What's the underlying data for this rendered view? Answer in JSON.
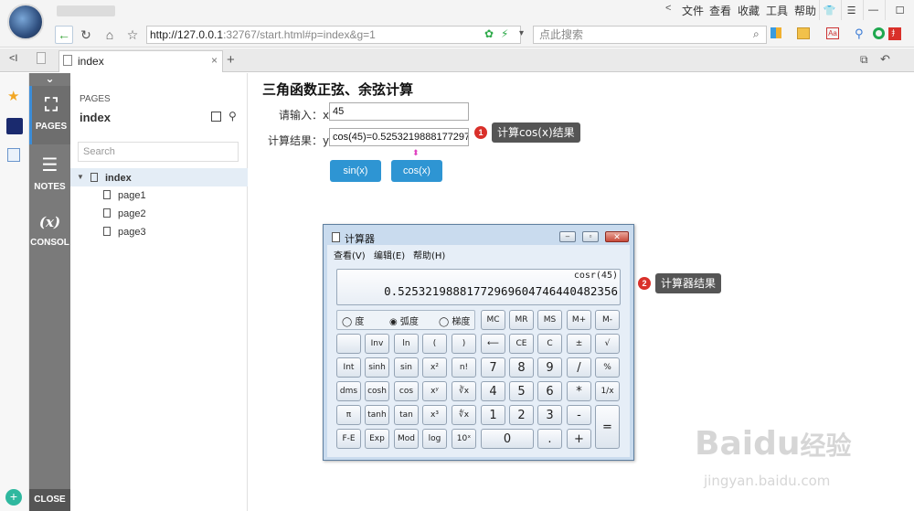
{
  "browser": {
    "menus": [
      "文件",
      "查看",
      "收藏",
      "工具",
      "帮助"
    ],
    "url_base": "http://127.0.0.1",
    "url_rest": ":32767/start.html#p=index&g=1",
    "search_placeholder": "点此搜索",
    "tab_title": "index"
  },
  "sidebar": {
    "pages_label": "PAGES",
    "notes_label": "NOTES",
    "console_label": "CONSOL",
    "console_icon": "(x)",
    "close_label": "CLOSE"
  },
  "pages_panel": {
    "heading_small": "PAGES",
    "title": "index",
    "search_placeholder": "Search",
    "tree": [
      {
        "label": "index",
        "level": 0
      },
      {
        "label": "page1",
        "level": 1
      },
      {
        "label": "page2",
        "level": 1
      },
      {
        "label": "page3",
        "level": 1
      }
    ]
  },
  "content": {
    "title": "三角函数正弦、余弦计算",
    "input_label": "请输入：x",
    "input_value": "45",
    "result_label": "计算结果：y",
    "result_value": "cos(45)=0.5253219888177297",
    "sin_button": "sin(x)",
    "cos_button": "cos(x)",
    "callout1_num": "1",
    "callout1_text": "计算cos(x)结果",
    "callout2_num": "2",
    "callout2_text": "计算器结果"
  },
  "calculator": {
    "title": "计算器",
    "menu": [
      "查看(V)",
      "编辑(E)",
      "帮助(H)"
    ],
    "expression": "cosr(45)",
    "result": "0.5253219888177296960474644048235​6",
    "modes": [
      "度",
      "弧度",
      "梯度"
    ],
    "selected_mode": "弧度",
    "memory_keys": [
      "MC",
      "MR",
      "MS",
      "M+",
      "M-"
    ],
    "rows": [
      [
        "",
        "Inv",
        "ln",
        "(",
        ")",
        "⟵",
        "CE",
        "C",
        "±",
        "√"
      ],
      [
        "Int",
        "sinh",
        "sin",
        "x²",
        "n!",
        "7",
        "8",
        "9",
        "/",
        "%"
      ],
      [
        "dms",
        "cosh",
        "cos",
        "xʸ",
        "∛x",
        "4",
        "5",
        "6",
        "*",
        "1/x"
      ],
      [
        "π",
        "tanh",
        "tan",
        "x³",
        "∜x",
        "1",
        "2",
        "3",
        "-",
        "="
      ],
      [
        "F-E",
        "Exp",
        "Mod",
        "log",
        "10ˣ",
        "0",
        ".",
        "+"
      ]
    ]
  },
  "watermark": {
    "brand": "Bai",
    "brand2": "du",
    "cn": "经验",
    "url": "jingyan.baidu.com"
  }
}
